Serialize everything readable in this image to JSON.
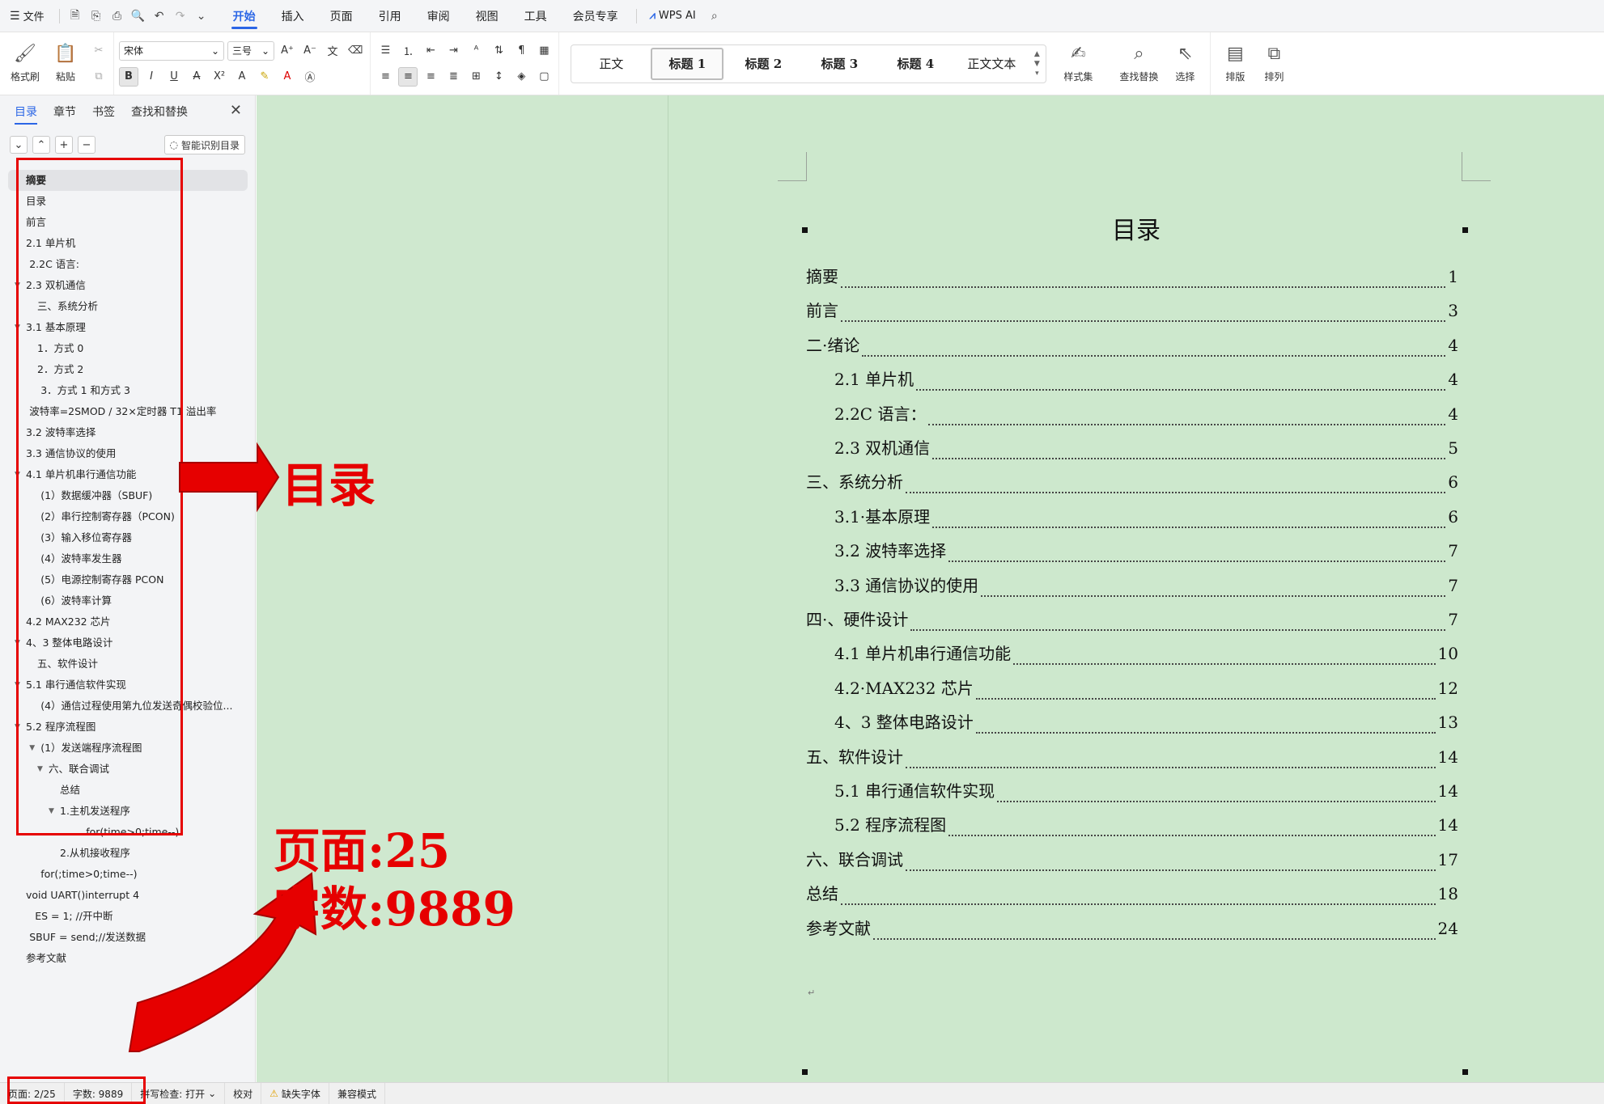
{
  "menubar": {
    "file_label": "文件",
    "tabs": [
      {
        "label": "开始",
        "active": true
      },
      {
        "label": "插入"
      },
      {
        "label": "页面"
      },
      {
        "label": "引用"
      },
      {
        "label": "审阅"
      },
      {
        "label": "视图"
      },
      {
        "label": "工具"
      },
      {
        "label": "会员专享"
      }
    ],
    "ai_label": "WPS AI"
  },
  "ribbon": {
    "format_painter": "格式刷",
    "paste": "粘贴",
    "font_name": "宋体",
    "font_size": "三号",
    "styles": [
      "正文",
      "标题 1",
      "标题 2",
      "标题 3",
      "标题 4",
      "正文文本"
    ],
    "style_set": "样式集",
    "find_replace": "查找替换",
    "select": "选择",
    "layout": "排版",
    "arrange": "排列"
  },
  "sidebar": {
    "tabs": [
      "目录",
      "章节",
      "书签",
      "查找和替换"
    ],
    "smart_toc": "智能识别目录",
    "items": [
      {
        "label": "摘要",
        "indent": 1,
        "selected": true
      },
      {
        "label": "目录",
        "indent": 1
      },
      {
        "label": "前言",
        "indent": 1
      },
      {
        "label": "2.1 单片机",
        "indent": 1
      },
      {
        "label": "2.2C 语言:",
        "indent": 1.3
      },
      {
        "label": "2.3 双机通信",
        "indent": 1,
        "arrow": true
      },
      {
        "label": "三、系统分析",
        "indent": 2
      },
      {
        "label": "3.1  基本原理",
        "indent": 1,
        "arrow": true
      },
      {
        "label": "1．方式 0",
        "indent": 2
      },
      {
        "label": "2．方式 2",
        "indent": 2
      },
      {
        "label": "3．方式 1 和方式 3",
        "indent": 2.3
      },
      {
        "label": "波特率=2SMOD / 32×定时器 T1 溢出率",
        "indent": 1.3
      },
      {
        "label": "3.2 波特率选择",
        "indent": 1
      },
      {
        "label": "3.3 通信协议的使用",
        "indent": 1
      },
      {
        "label": "4.1 单片机串行通信功能",
        "indent": 1,
        "arrow": true
      },
      {
        "label": "(1）数据缓冲器（SBUF)",
        "indent": 2.3
      },
      {
        "label": "(2）串行控制寄存器（PCON)",
        "indent": 2.3
      },
      {
        "label": "(3）输入移位寄存器",
        "indent": 2.3
      },
      {
        "label": "(4）波特率发生器",
        "indent": 2.3
      },
      {
        "label": "(5）电源控制寄存器 PCON",
        "indent": 2.3
      },
      {
        "label": "(6）波特率计算",
        "indent": 2.3
      },
      {
        "label": "4.2 MAX232 芯片",
        "indent": 1
      },
      {
        "label": "4、3 整体电路设计",
        "indent": 1,
        "arrow": true
      },
      {
        "label": "五、软件设计",
        "indent": 2
      },
      {
        "label": "5.1 串行通信软件实现",
        "indent": 1,
        "arrow": true
      },
      {
        "label": "(4）通信过程使用第九位发送奇偶校验位...",
        "indent": 2.3
      },
      {
        "label": "5.2 程序流程图",
        "indent": 1,
        "arrow": true
      },
      {
        "label": "(1）发送端程序流程图",
        "indent": 2.3,
        "arrow": true
      },
      {
        "label": "六、联合调试",
        "indent": 3,
        "arrow": true
      },
      {
        "label": "总结",
        "indent": 4
      },
      {
        "label": "1.主机发送程序",
        "indent": 4,
        "arrow": true
      },
      {
        "label": "for(time>0;time--)",
        "indent": 6.3
      },
      {
        "label": "2.从机接收程序",
        "indent": 4
      },
      {
        "label": "for(;time>0;time--)",
        "indent": 2.3
      },
      {
        "label": "void UART()interrupt 4",
        "indent": 1
      },
      {
        "label": "ES = 1;       //开中断",
        "indent": 1.8
      },
      {
        "label": "SBUF = send;//发送数据",
        "indent": 1.3
      },
      {
        "label": "参考文献",
        "indent": 1
      }
    ]
  },
  "document": {
    "title": "目录",
    "toc": [
      {
        "text": "摘要",
        "page": "1",
        "level": 1
      },
      {
        "text": "前言",
        "page": "3",
        "level": 1
      },
      {
        "text": "二·绪论",
        "page": "4",
        "level": 1
      },
      {
        "text": "2.1 单片机",
        "page": "4",
        "level": 2
      },
      {
        "text": "2.2C 语言：",
        "page": "4",
        "level": 2
      },
      {
        "text": "2.3 双机通信",
        "page": "5",
        "level": 2
      },
      {
        "text": "三、系统分析",
        "page": "6",
        "level": 1
      },
      {
        "text": "3.1·基本原理",
        "page": "6",
        "level": 2
      },
      {
        "text": "3.2 波特率选择",
        "page": "7",
        "level": 2
      },
      {
        "text": "3.3 通信协议的使用",
        "page": "7",
        "level": 2
      },
      {
        "text": "四·、硬件设计",
        "page": "7",
        "level": 1
      },
      {
        "text": "4.1 单片机串行通信功能",
        "page": "10",
        "level": 2
      },
      {
        "text": "4.2·MAX232 芯片",
        "page": "12",
        "level": 2
      },
      {
        "text": "4、3 整体电路设计",
        "page": "13",
        "level": 2
      },
      {
        "text": "五、软件设计",
        "page": "14",
        "level": 1
      },
      {
        "text": "5.1 串行通信软件实现",
        "page": "14",
        "level": 2
      },
      {
        "text": "5.2 程序流程图",
        "page": "14",
        "level": 2
      },
      {
        "text": "六、联合调试",
        "page": "17",
        "level": 1
      },
      {
        "text": "总结",
        "page": "18",
        "level": 1
      },
      {
        "text": "参考文献",
        "page": "24",
        "level": 1
      }
    ]
  },
  "statusbar": {
    "page": "页面: 2/25",
    "words": "字数: 9889",
    "spellcheck": "拼写检查: 打开",
    "proofread": "校对",
    "missing_font": "缺失字体",
    "compat": "兼容模式"
  },
  "annotations": {
    "toc_label": "目录",
    "pages_label": "页面:25",
    "words_label": "字数:9889",
    "color": "#e60000"
  }
}
